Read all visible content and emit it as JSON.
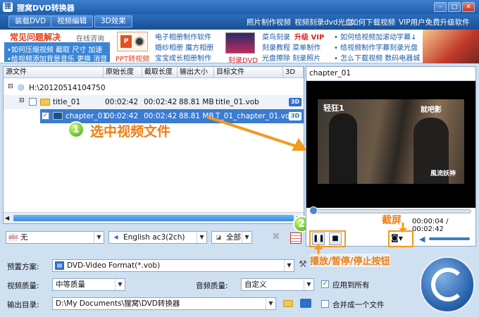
{
  "title": "狸窝DVD转换器",
  "menu": {
    "load_dvd": "装载DVD",
    "video_edit": "视频编辑",
    "effect_3d": "3D效果",
    "links": [
      "照片制作视频",
      "视频刻录dvd光盘",
      "如何下载视频",
      "VIP用户免费升级软件"
    ]
  },
  "banner": {
    "faq_title": "常见问题解决",
    "faq_online": "在线咨询",
    "faq_line1": "•如何压缩视频  截取  尺寸  加速",
    "faq_line2": "•给视频添加背景音乐  更换  消音",
    "ppt_label": "PPT转视频",
    "col2": [
      "电子相册制作软件",
      "婚纱相册  魔方相册",
      "宝宝成长相册制作"
    ],
    "burn_label": "刻录DVD",
    "col3_line1": "菜鸟刻录",
    "col3_vip": "升级 VIP",
    "col3_line2": "刻录教程  菜单制作",
    "col3_line3": "光盘擦除  刻录照片",
    "col4": [
      "• 如何给视频加滚动字幕↓",
      "• 给视频制作字幕刻录光盘",
      "• 怎么下载视频  数码电器城"
    ]
  },
  "table": {
    "headers": [
      "源文件",
      "原始长度",
      "截取长度",
      "输出大小",
      "目标文件",
      "3D"
    ],
    "root": "H:\\20120514104750",
    "rows": [
      {
        "name": "title_01",
        "orig": "00:02:42",
        "clip": "00:02:42",
        "size": "88.81 MB",
        "target": "title_01.vob",
        "badge": "3D"
      },
      {
        "name": "chapter_01",
        "orig": "00:02:42",
        "clip": "00:02:42",
        "size": "88.81 MB",
        "target": "T_01_chapter_01.vob",
        "badge": "3D"
      }
    ]
  },
  "annotations": {
    "step1_num": "1",
    "step1_text": "选中视频文件",
    "step2_num": "2",
    "screenshot_text": "截屏",
    "playstop_text": "播放/暂停/停止按钮"
  },
  "toolbar": {
    "subtitle": "无",
    "audio": "English ac3(2ch)",
    "range": "全部"
  },
  "preview": {
    "title": "chapter_01",
    "time_current": "00:00:04",
    "time_total": "00:02:42",
    "caption_tl": "轻狂1",
    "caption_tr": "就吧影",
    "caption_br": "風流妖神"
  },
  "form": {
    "preset_label": "预置方案:",
    "preset_value": "DVD-Video Format(*.vob)",
    "vquality_label": "视频质量:",
    "vquality_value": "中等质量",
    "aquality_label": "音频质量:",
    "aquality_value": "自定义",
    "apply_all": "应用到所有",
    "output_label": "输出目录:",
    "output_value": "D:\\My Documents\\狸窝\\DVD转换器",
    "merge": "合并成一个文件"
  },
  "colors": {
    "accent": "#2b6dbd",
    "annotation": "#f07d12",
    "selection": "#3b7bd0"
  }
}
